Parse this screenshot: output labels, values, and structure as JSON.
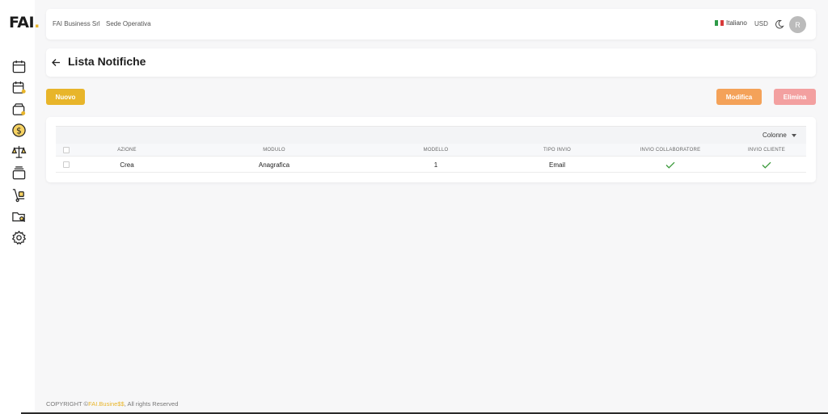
{
  "brand": {
    "logo_text": "FAI",
    "logo_dot": "."
  },
  "sidebar": {
    "items": [
      {
        "icon": "calendar-icon"
      },
      {
        "icon": "calendar-user-icon"
      },
      {
        "icon": "wallet-icon"
      },
      {
        "icon": "dollar-coin-icon"
      },
      {
        "icon": "scale-icon"
      },
      {
        "icon": "cards-icon"
      },
      {
        "icon": "hand-truck-icon"
      },
      {
        "icon": "folder-search-icon"
      },
      {
        "icon": "gear-icon"
      }
    ]
  },
  "header": {
    "company": "FAI Business Srl",
    "branch": "Sede Operativa",
    "language": "Italiano",
    "currency": "USD",
    "avatar_initial": "R"
  },
  "page": {
    "title": "Lista Notifiche"
  },
  "actions": {
    "new_label": "Nuovo",
    "edit_label": "Modifica",
    "delete_label": "Elimina"
  },
  "table": {
    "columns_button": "Colonne",
    "headers": [
      "AZIONE",
      "MODULO",
      "MODELLO",
      "TIPO INVIO",
      "INVIO COLLABORATORE",
      "INVIO CLIENTE"
    ],
    "rows": [
      {
        "azione": "Crea",
        "modulo": "Anagrafica",
        "modello": "1",
        "tipo_invio": "Email",
        "invio_collaboratore": true,
        "invio_cliente": true
      }
    ]
  },
  "footer": {
    "prefix": "COPYRIGHT ©",
    "brand": "FAI.Busine$$",
    "suffix": ", All rights Reserved"
  },
  "colors": {
    "accent": "#e8b52a",
    "edit": "#f4a259",
    "delete": "#f3a0a0",
    "check": "#3a9a3a"
  }
}
